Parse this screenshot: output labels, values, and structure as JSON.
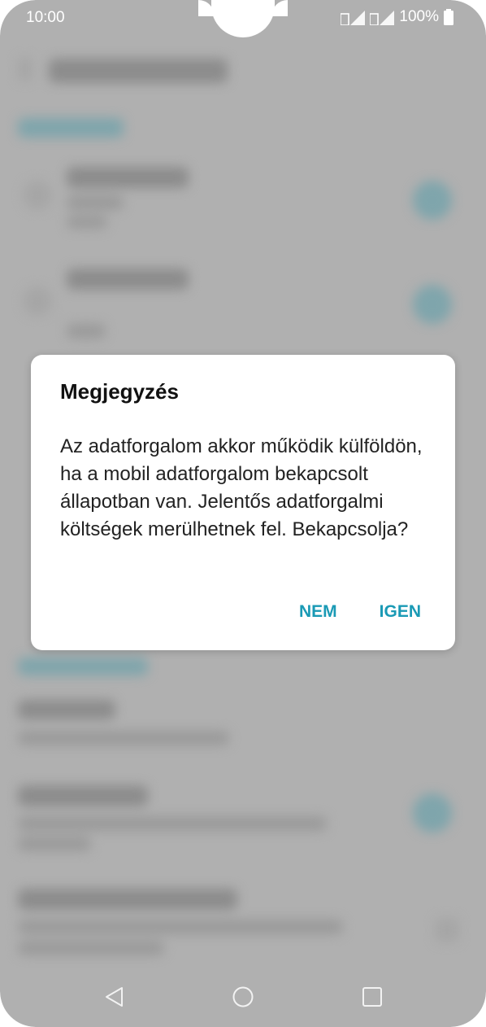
{
  "status_bar": {
    "time": "10:00",
    "battery_percent": "100%",
    "icons": [
      "sim1-signal-icon",
      "sim2-signal-icon",
      "battery-icon"
    ]
  },
  "dialog": {
    "title": "Megjegyzés",
    "message": "Az adatforgalom akkor működik külföldön, ha a mobil adatforgalom bekapcsolt állapotban van. Jelentős adatforgalmi költségek merülhetnek fel. Bekapcsolja?",
    "negative_label": "NEM",
    "positive_label": "IGEN"
  },
  "colors": {
    "accent": "#1a9ab5",
    "scrim": "#b0b0b0"
  },
  "nav_bar": {
    "icons": [
      "back-icon",
      "home-icon",
      "recents-icon"
    ]
  }
}
